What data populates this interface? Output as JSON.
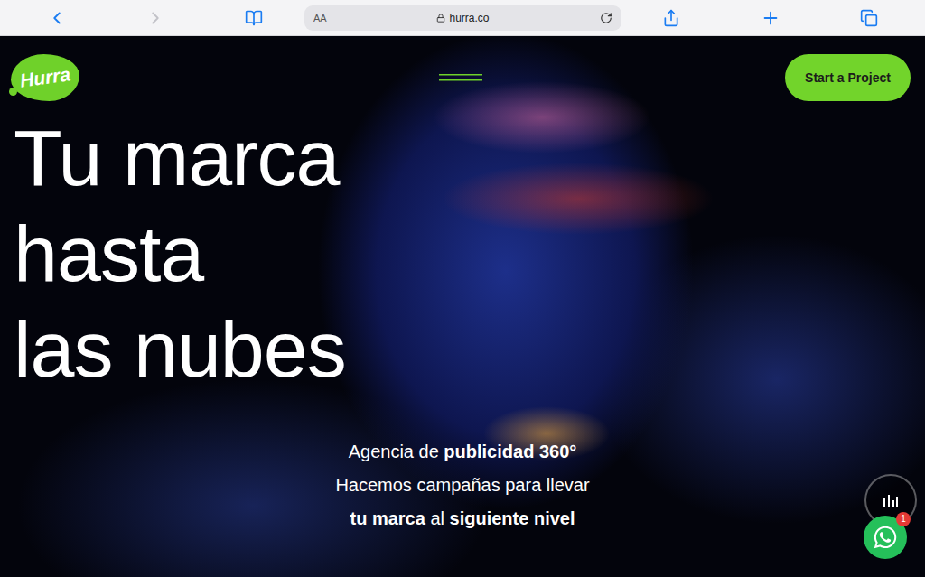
{
  "browser": {
    "toolbar": {
      "back_enabled": true,
      "forward_enabled": false
    },
    "address_bar": {
      "reader_label": "AA",
      "url": "hurra.co",
      "secure": true
    }
  },
  "page": {
    "logo": "Hurra",
    "cta": "Start a Project",
    "headline": [
      "Tu marca",
      "hasta",
      "las nubes"
    ],
    "tagline": [
      [
        {
          "text": "Agencia de ",
          "bold": false
        },
        {
          "text": "publicidad 360°",
          "bold": true
        }
      ],
      [
        {
          "text": "Hacemos campañas para llevar",
          "bold": false
        }
      ],
      [
        {
          "text": "tu marca",
          "bold": true
        },
        {
          "text": " al ",
          "bold": false
        },
        {
          "text": "siguiente nivel",
          "bold": true
        }
      ]
    ],
    "chat_widget": {
      "badge": "1"
    }
  }
}
